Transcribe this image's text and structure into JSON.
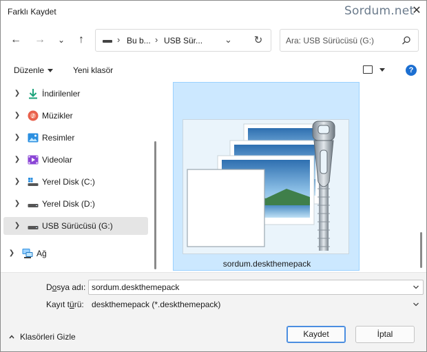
{
  "window": {
    "title": "Farklı Kaydet",
    "watermark": "Sordum.net",
    "close_label": "✕"
  },
  "nav": {
    "back_label": "←",
    "forward_label": "→",
    "recent_label": "⌄",
    "up_label": "↑",
    "breadcrumb": [
      {
        "label": "Bu b..."
      },
      {
        "label": "USB Sür..."
      }
    ],
    "refresh_label": "↻"
  },
  "search": {
    "placeholder": "Ara: USB Sürücüsü (G:)"
  },
  "toolbar": {
    "organize": "Düzenle",
    "new_folder": "Yeni klasör",
    "help": "?"
  },
  "sidebar": {
    "items": [
      {
        "label": "İndirilenler",
        "icon": "download-icon"
      },
      {
        "label": "Müzikler",
        "icon": "music-icon"
      },
      {
        "label": "Resimler",
        "icon": "pictures-icon"
      },
      {
        "label": "Videolar",
        "icon": "videos-icon"
      },
      {
        "label": "Yerel Disk (C:)",
        "icon": "windows-drive-icon"
      },
      {
        "label": "Yerel Disk (D:)",
        "icon": "drive-icon"
      },
      {
        "label": "USB Sürücüsü (G:)",
        "icon": "usb-drive-icon",
        "selected": true
      },
      {
        "label": "Ağ",
        "icon": "network-icon"
      }
    ]
  },
  "content": {
    "files": [
      {
        "name": "sordum.deskthemepack",
        "icon": "deskthemepack-icon",
        "selected": true
      }
    ]
  },
  "form": {
    "filename_label_pre": "D",
    "filename_label_ul": "o",
    "filename_label_post": "sya adı:",
    "filename_value": "sordum.deskthemepack",
    "filetype_label_pre": "Kayıt t",
    "filetype_label_ul": "ü",
    "filetype_label_post": "rü:",
    "filetype_value": "deskthemepack (*.deskthemepack)"
  },
  "footer": {
    "hide_folders": "Klasörleri Gizle",
    "save": "Kaydet",
    "cancel": "İptal"
  },
  "colors": {
    "accent": "#1c6fd1",
    "selection": "#cce8ff",
    "selection_border": "#99d1ff"
  }
}
